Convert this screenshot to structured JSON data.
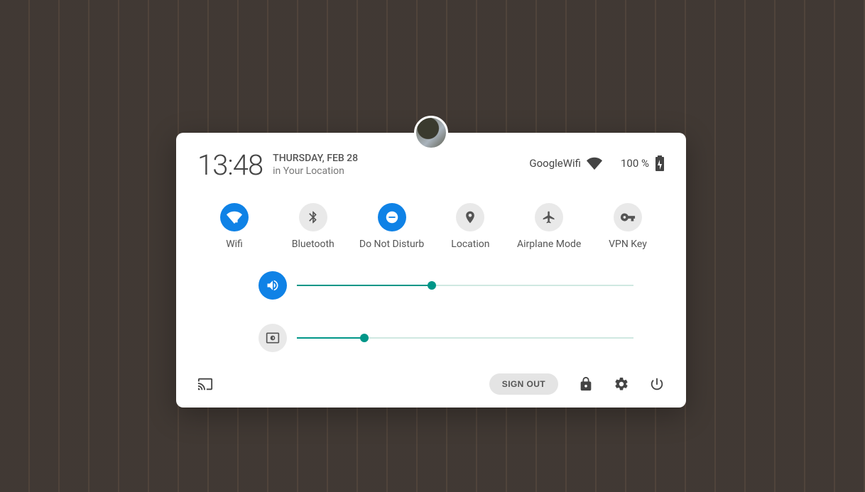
{
  "header": {
    "time": "13:48",
    "date": "THURSDAY, FEB 28",
    "location": "in Your Location",
    "network_name": "GoogleWifi",
    "battery_percent": "100 %"
  },
  "toggles": {
    "wifi": {
      "label": "Wifi",
      "active": true
    },
    "bluetooth": {
      "label": "Bluetooth",
      "active": false
    },
    "dnd": {
      "label": "Do Not Disturb",
      "active": true
    },
    "location": {
      "label": "Location",
      "active": false
    },
    "airplane": {
      "label": "Airplane Mode",
      "active": false
    },
    "vpn": {
      "label": "VPN Key",
      "active": false
    }
  },
  "sliders": {
    "volume": {
      "percent": 40
    },
    "brightness": {
      "percent": 20
    }
  },
  "footer": {
    "signout_label": "SIGN OUT"
  },
  "colors": {
    "accent": "#0f82e6",
    "slider": "#009688"
  }
}
